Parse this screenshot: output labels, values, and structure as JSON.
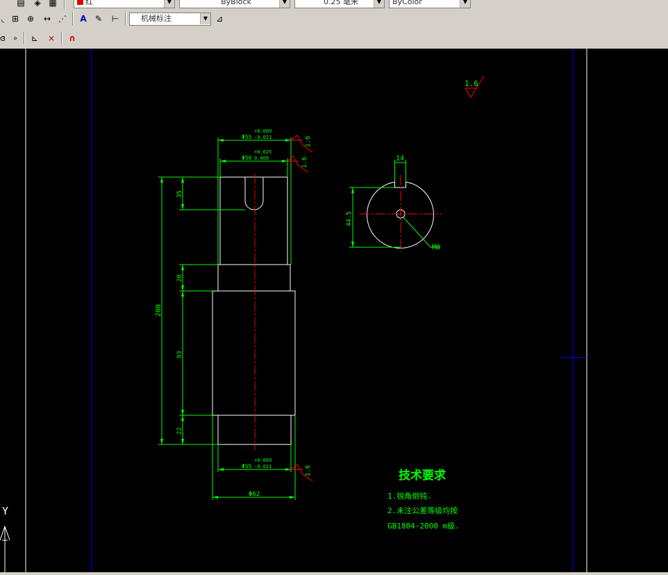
{
  "toolbar": {
    "row1": {
      "color_combo": "红",
      "linetype_combo": "ByBlock",
      "lineweight_combo": "0.25 毫米",
      "plotstyle_combo": "ByColor"
    },
    "row2": {
      "dimstyle_combo": "机械标注"
    }
  },
  "drawing": {
    "roughness_top": "1.6",
    "roughness_1": "1.6",
    "roughness_2": "1.6",
    "roughness_3": "1.6",
    "tol_top_1": "+0.009",
    "tol_bot_1": "-0.021",
    "dia_1": "Φ55",
    "tol_top_2": "+0.025",
    "tol_bot_2": "0.000",
    "dia_2": "Φ50",
    "tol_top_3": "+0.009",
    "tol_bot_3": "-0.021",
    "dia_3": "Φ55",
    "dia_4": "Φ62",
    "dim_total": "200",
    "dim_35": "35",
    "dim_20": "20",
    "dim_93": "93",
    "dim_22": "22",
    "keyway_width": "14",
    "keyway_depth": "44.5",
    "thread": "M8",
    "tech_title": "技术要求",
    "tech_line1": "1.锐角倒钝.",
    "tech_line2": "2.未注公差等级均按",
    "tech_line3": "GB1804-2000 m级."
  },
  "ucs": {
    "y_label": "Y"
  },
  "colors": {
    "dimension": "#00ff00",
    "centerline": "#ff0000",
    "outline": "#ffffff",
    "border": "#0000ff",
    "background": "#000000"
  }
}
